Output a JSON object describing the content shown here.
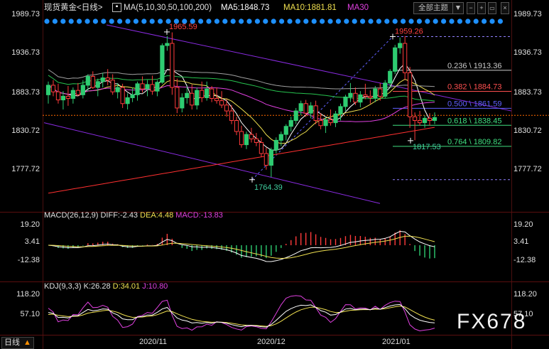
{
  "header": {
    "title": "现货黄金<日线>",
    "ma_params": "MA(5,10,30,50,100,200)",
    "ma5": "MA5:1848.73",
    "ma10": "MA10:1881.81",
    "ma30": "MA30",
    "theme_label": "全部主题",
    "theme_arrow": "▼"
  },
  "colors": {
    "bull": "#2ecc71",
    "bear": "#ff3b3b",
    "ma5": "#ffffff",
    "ma10": "#f0e050",
    "ma30": "#e040e0",
    "ma50": "#27c44f",
    "ma100": "#a0a0a0",
    "ma200": "#ff3030",
    "channel": "#8a2be2",
    "fib": "#9080ff",
    "panel_separator": "#5a0f0f",
    "background": "#000000"
  },
  "price_axis": {
    "ticks": [
      "1989.73",
      "1936.73",
      "1883.73",
      "1830.72",
      "1777.72"
    ]
  },
  "macd_axis": {
    "ticks": [
      "19.20",
      "3.41",
      "-12.38"
    ]
  },
  "kdj_axis": {
    "ticks": [
      "118.20",
      "57.10"
    ]
  },
  "x_axis": {
    "ticks": [
      "2020/11",
      "2020/12",
      "2021/01"
    ]
  },
  "annotations": {
    "high1": "1965.59",
    "high2": "1959.26",
    "low1": "1764.39",
    "low2": "1817.53"
  },
  "fib_levels": [
    {
      "label": "0.236 \\ 1913.36",
      "color": "#cccccc"
    },
    {
      "label": "0.382 \\ 1884.73",
      "color": "#ff5050"
    },
    {
      "label": "0.500 \\ 1861.59",
      "color": "#6060ff"
    },
    {
      "label": "0.618 \\ 1838.45",
      "color": "#40e080"
    },
    {
      "label": "0.764 \\ 1809.82",
      "color": "#40e080"
    }
  ],
  "macd": {
    "label": "MACD(26,12,9)",
    "diff": "DIFF:-2.43",
    "dea": "DEA:4.48",
    "macd": "MACD:-13.83"
  },
  "kdj": {
    "label": "KDJ(9,3,3)",
    "k": "K:26.28",
    "d": "D:34.01",
    "j": "J:10.80"
  },
  "footer": {
    "period": "日线",
    "watermark": "FX678"
  },
  "chart_data": {
    "type": "candlestick",
    "series": [
      {
        "name": "MA5",
        "value": 1848.73
      },
      {
        "name": "MA10",
        "value": 1881.81
      }
    ],
    "price_range": [
      1760,
      1995
    ],
    "annotated_prices": [
      1965.59,
      1959.26,
      1764.39,
      1817.53
    ],
    "fibonacci": [
      {
        "ratio": 0.236,
        "price": 1913.36
      },
      {
        "ratio": 0.382,
        "price": 1884.73
      },
      {
        "ratio": 0.5,
        "price": 1861.59
      },
      {
        "ratio": 0.618,
        "price": 1838.45
      },
      {
        "ratio": 0.764,
        "price": 1809.82
      }
    ],
    "macd": {
      "params": [
        26,
        12,
        9
      ],
      "diff": -2.43,
      "dea": 4.48,
      "macd": -13.83
    },
    "kdj": {
      "params": [
        9,
        3,
        3
      ],
      "k": 26.28,
      "d": 34.01,
      "j": 10.8
    },
    "x_ticks": [
      "2020/11",
      "2020/12",
      "2021/01"
    ],
    "candles_ohlc": [
      [
        1880,
        1898,
        1868,
        1893
      ],
      [
        1893,
        1900,
        1878,
        1884
      ],
      [
        1884,
        1895,
        1868,
        1873
      ],
      [
        1873,
        1885,
        1860,
        1878
      ],
      [
        1878,
        1892,
        1865,
        1875
      ],
      [
        1875,
        1890,
        1868,
        1886
      ],
      [
        1886,
        1896,
        1878,
        1880
      ],
      [
        1880,
        1900,
        1875,
        1893
      ],
      [
        1893,
        1908,
        1885,
        1905
      ],
      [
        1905,
        1912,
        1888,
        1890
      ],
      [
        1890,
        1902,
        1878,
        1898
      ],
      [
        1898,
        1910,
        1890,
        1903
      ],
      [
        1903,
        1915,
        1893,
        1900
      ],
      [
        1900,
        1908,
        1880,
        1884
      ],
      [
        1884,
        1896,
        1875,
        1890
      ],
      [
        1890,
        1895,
        1862,
        1868
      ],
      [
        1868,
        1882,
        1860,
        1876
      ],
      [
        1876,
        1890,
        1870,
        1880
      ],
      [
        1880,
        1898,
        1872,
        1895
      ],
      [
        1895,
        1905,
        1883,
        1888
      ],
      [
        1888,
        1900,
        1878,
        1894
      ],
      [
        1894,
        1906,
        1880,
        1885
      ],
      [
        1885,
        1900,
        1878,
        1897
      ],
      [
        1897,
        1950,
        1895,
        1947
      ],
      [
        1947,
        1960,
        1940,
        1950
      ],
      [
        1950,
        1965,
        1880,
        1890
      ],
      [
        1890,
        1902,
        1855,
        1862
      ],
      [
        1862,
        1882,
        1856,
        1876
      ],
      [
        1876,
        1892,
        1868,
        1882
      ],
      [
        1882,
        1894,
        1860,
        1866
      ],
      [
        1866,
        1890,
        1860,
        1886
      ],
      [
        1886,
        1898,
        1870,
        1876
      ],
      [
        1876,
        1898,
        1872,
        1888
      ],
      [
        1888,
        1892,
        1870,
        1875
      ],
      [
        1875,
        1890,
        1868,
        1872
      ],
      [
        1872,
        1885,
        1862,
        1866
      ],
      [
        1866,
        1874,
        1850,
        1858
      ],
      [
        1858,
        1866,
        1840,
        1845
      ],
      [
        1845,
        1850,
        1825,
        1830
      ],
      [
        1830,
        1838,
        1808,
        1812
      ],
      [
        1812,
        1830,
        1806,
        1826
      ],
      [
        1826,
        1835,
        1815,
        1820
      ],
      [
        1820,
        1828,
        1810,
        1815
      ],
      [
        1815,
        1822,
        1795,
        1800
      ],
      [
        1800,
        1808,
        1778,
        1784
      ],
      [
        1784,
        1808,
        1768,
        1805
      ],
      [
        1805,
        1822,
        1800,
        1818
      ],
      [
        1818,
        1830,
        1810,
        1826
      ],
      [
        1826,
        1840,
        1818,
        1837
      ],
      [
        1837,
        1850,
        1830,
        1845
      ],
      [
        1845,
        1862,
        1840,
        1858
      ],
      [
        1858,
        1872,
        1852,
        1868
      ],
      [
        1868,
        1873,
        1850,
        1855
      ],
      [
        1855,
        1870,
        1848,
        1865
      ],
      [
        1865,
        1872,
        1840,
        1845
      ],
      [
        1845,
        1855,
        1833,
        1838
      ],
      [
        1838,
        1850,
        1828,
        1846
      ],
      [
        1846,
        1860,
        1838,
        1842
      ],
      [
        1842,
        1858,
        1836,
        1854
      ],
      [
        1854,
        1868,
        1845,
        1864
      ],
      [
        1864,
        1880,
        1858,
        1877
      ],
      [
        1877,
        1896,
        1870,
        1882
      ],
      [
        1882,
        1890,
        1866,
        1870
      ],
      [
        1870,
        1885,
        1863,
        1880
      ],
      [
        1880,
        1895,
        1874,
        1878
      ],
      [
        1878,
        1886,
        1868,
        1876
      ],
      [
        1876,
        1892,
        1870,
        1888
      ],
      [
        1888,
        1896,
        1872,
        1878
      ],
      [
        1878,
        1900,
        1875,
        1896
      ],
      [
        1896,
        1915,
        1890,
        1912
      ],
      [
        1912,
        1948,
        1908,
        1944
      ],
      [
        1944,
        1958,
        1936,
        1950
      ],
      [
        1950,
        1960,
        1900,
        1910
      ],
      [
        1910,
        1918,
        1835,
        1850
      ],
      [
        1850,
        1856,
        1818,
        1845
      ],
      [
        1845,
        1858,
        1838,
        1842
      ],
      [
        1842,
        1852,
        1835,
        1848
      ],
      [
        1848,
        1855,
        1838,
        1845
      ],
      [
        1845,
        1856,
        1840,
        1849
      ]
    ]
  }
}
